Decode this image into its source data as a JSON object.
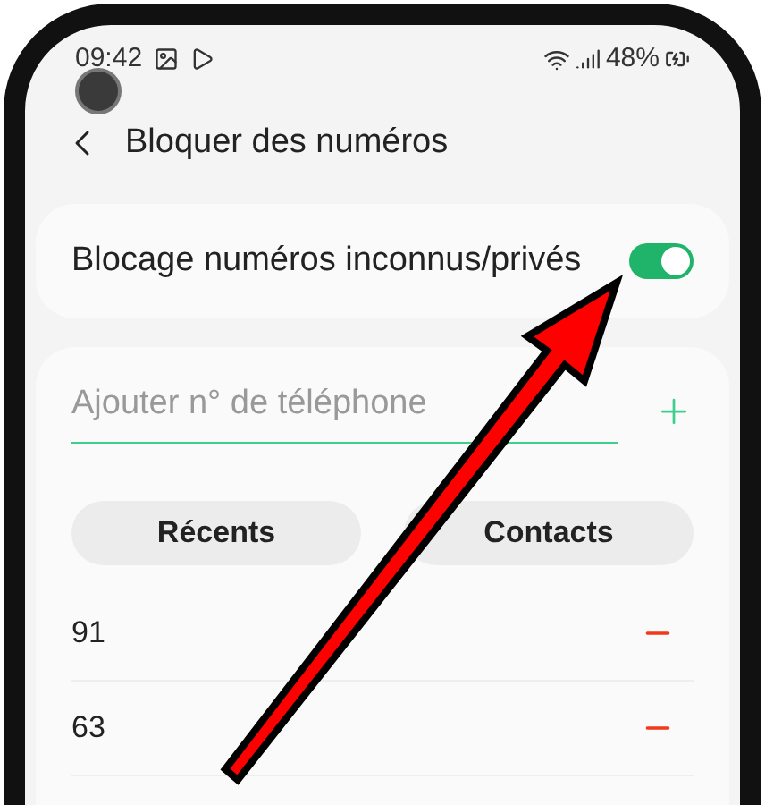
{
  "status_bar": {
    "time": "09:42",
    "battery": "48%"
  },
  "header": {
    "title": "Bloquer des numéros"
  },
  "block_unknown": {
    "label": "Blocage numéros inconnus/privés",
    "on": true
  },
  "add_field": {
    "placeholder": "Ajouter n° de téléphone"
  },
  "buttons": [
    "Récents",
    "Contacts"
  ],
  "numbers": [
    "91",
    "63"
  ]
}
